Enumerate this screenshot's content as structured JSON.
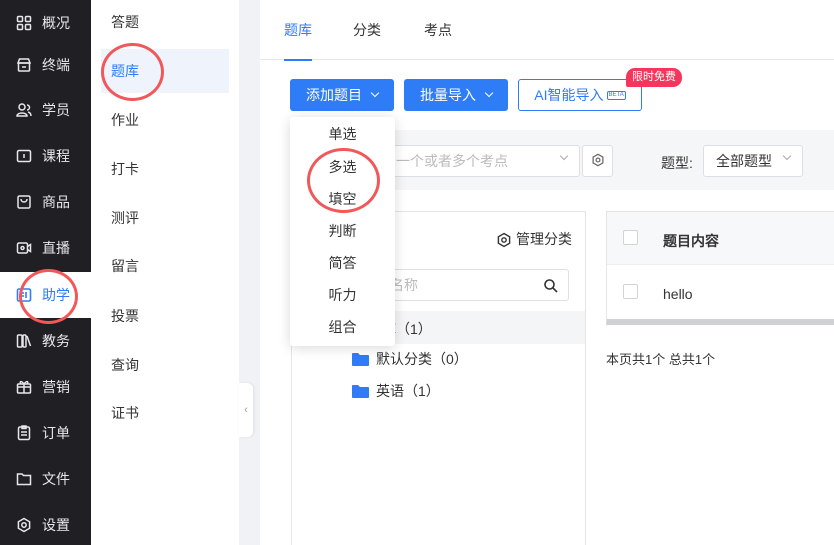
{
  "sidebar": {
    "items": [
      {
        "label": "概况",
        "icon": "grid-icon"
      },
      {
        "label": "终端",
        "icon": "store-icon"
      },
      {
        "label": "学员",
        "icon": "users-icon"
      },
      {
        "label": "课程",
        "icon": "course-icon"
      },
      {
        "label": "商品",
        "icon": "bag-icon"
      },
      {
        "label": "直播",
        "icon": "video-icon"
      },
      {
        "label": "助学",
        "icon": "assist-icon",
        "active": true
      },
      {
        "label": "教务",
        "icon": "book-icon"
      },
      {
        "label": "营销",
        "icon": "gift-icon"
      },
      {
        "label": "订单",
        "icon": "order-icon"
      },
      {
        "label": "文件",
        "icon": "folder-icon"
      },
      {
        "label": "设置",
        "icon": "settings-icon"
      }
    ]
  },
  "subnav": {
    "items": [
      {
        "label": "答题"
      },
      {
        "label": "题库",
        "active": true
      },
      {
        "label": "作业"
      },
      {
        "label": "打卡"
      },
      {
        "label": "测评"
      },
      {
        "label": "留言"
      },
      {
        "label": "投票"
      },
      {
        "label": "查询"
      },
      {
        "label": "证书"
      }
    ]
  },
  "tabs": [
    {
      "label": "题库",
      "active": true
    },
    {
      "label": "分类"
    },
    {
      "label": "考点"
    }
  ],
  "toolbar": {
    "add_question": "添加题目",
    "batch_import": "批量导入",
    "ai_import": "AI智能导入",
    "beta": "BETA",
    "promo": "限时免费"
  },
  "dropdown": {
    "items": [
      "单选",
      "多选",
      "填空",
      "判断",
      "简答",
      "听力",
      "组合"
    ]
  },
  "filter": {
    "knowledge_point_placeholder": "一个或者多个考点",
    "type_label": "题型:",
    "type_value": "全部题型"
  },
  "category": {
    "manage": "管理分类",
    "search_placeholder": "名称",
    "root": "库（1）",
    "children": [
      {
        "label": "默认分类（0）"
      },
      {
        "label": "英语（1）"
      }
    ]
  },
  "table": {
    "header": "题目内容",
    "rows": [
      {
        "content": "hello"
      }
    ],
    "pager": "本页共1个 总共1个"
  },
  "colors": {
    "accent": "#2e7cf6",
    "sidebar_bg": "#1f1f24",
    "promo": "#f5365c",
    "annotation": "#f0585a"
  }
}
